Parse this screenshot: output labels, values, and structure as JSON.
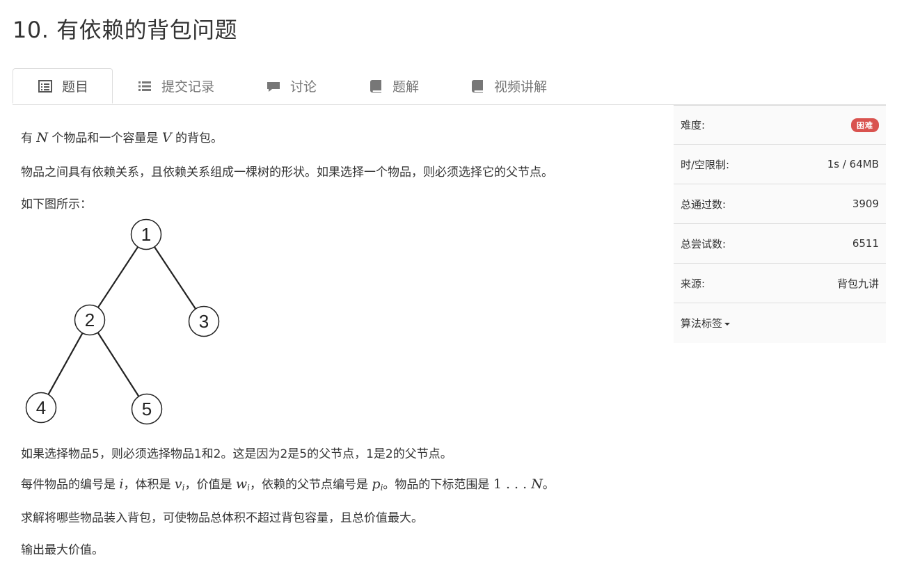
{
  "page": {
    "title": "10. 有依赖的背包问题"
  },
  "tabs": [
    {
      "label": "题目",
      "icon": "list-alt-icon",
      "active": true
    },
    {
      "label": "提交记录",
      "icon": "list-icon",
      "active": false
    },
    {
      "label": "讨论",
      "icon": "comment-icon",
      "active": false
    },
    {
      "label": "题解",
      "icon": "book-icon",
      "active": false
    },
    {
      "label": "视频讲解",
      "icon": "book-icon",
      "active": false
    }
  ],
  "problem": {
    "line1": {
      "a": "有 ",
      "N": "N",
      "b": " 个物品和一个容量是 ",
      "V": "V",
      "c": " 的背包。"
    },
    "line2": "物品之间具有依赖关系，且依赖关系组成一棵树的形状。如果选择一个物品，则必须选择它的父节点。",
    "line3": "如下图所示：",
    "tree": {
      "nodes": [
        {
          "id": "1",
          "label": "1"
        },
        {
          "id": "2",
          "label": "2"
        },
        {
          "id": "3",
          "label": "3"
        },
        {
          "id": "4",
          "label": "4"
        },
        {
          "id": "5",
          "label": "5"
        }
      ],
      "edges": [
        [
          "1",
          "2"
        ],
        [
          "1",
          "3"
        ],
        [
          "2",
          "4"
        ],
        [
          "2",
          "5"
        ]
      ]
    },
    "line4": "如果选择物品5，则必须选择物品1和2。这是因为2是5的父节点，1是2的父节点。",
    "line5": {
      "a": "每件物品的编号是 ",
      "i": "i",
      "b": "，体积是 ",
      "v": "v",
      "vi": "i",
      "c": "，价值是 ",
      "w": "w",
      "wi": "i",
      "d": "，依赖的父节点编号是 ",
      "p": "p",
      "pi": "i",
      "e": "。物品的下标范围是 ",
      "range1": "1 . . . ",
      "rangeN": "N",
      "f": "。"
    },
    "line6": "求解将哪些物品装入背包，可使物品总体积不超过背包容量，且总价值最大。",
    "line7": "输出最大价值。"
  },
  "sidebar": {
    "difficulty": {
      "label": "难度:",
      "value": "困难",
      "color": "#d9534f"
    },
    "limits": {
      "label": "时/空限制:",
      "value": "1s / 64MB"
    },
    "accepted": {
      "label": "总通过数:",
      "value": "3909"
    },
    "attempts": {
      "label": "总尝试数:",
      "value": "6511"
    },
    "source": {
      "label": "来源:",
      "value": "背包九讲"
    },
    "tags": {
      "label": "算法标签"
    }
  }
}
